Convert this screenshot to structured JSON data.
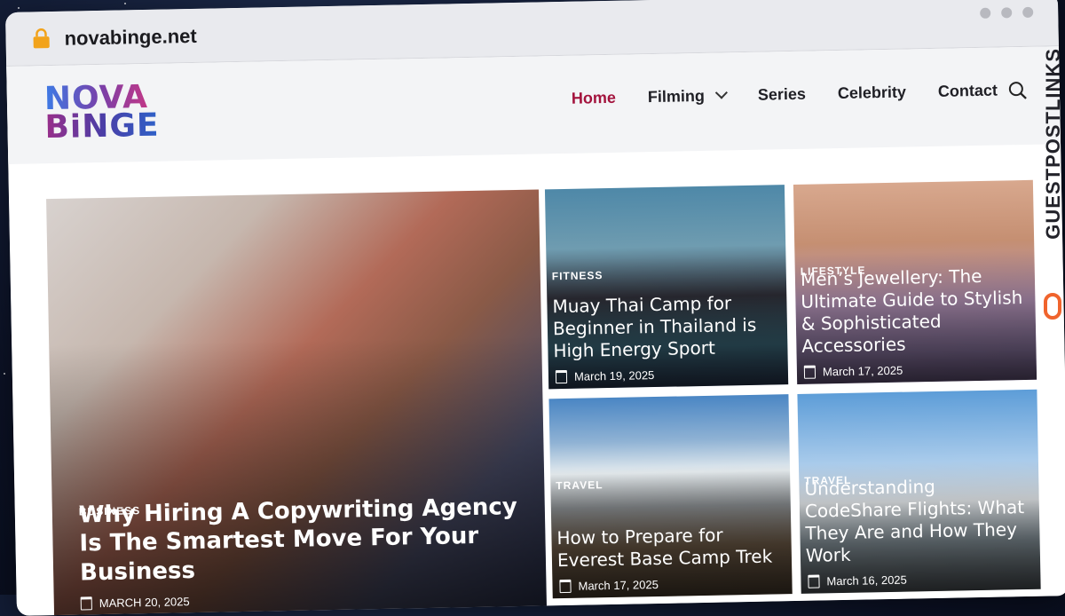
{
  "browser": {
    "url": "novabinge.net"
  },
  "logo": {
    "line1": "NOVA",
    "line2": "BiNGE"
  },
  "nav": {
    "items": [
      "Home",
      "Filming",
      "Series",
      "Celebrity",
      "Contact"
    ]
  },
  "cards": [
    {
      "category": "BUSINESS",
      "title": "Why Hiring A Copywriting Agency Is The Smartest Move For Your Business",
      "date": "MARCH 20, 2025"
    },
    {
      "category": "FITNESS",
      "title": "Muay Thai Camp for Beginner in Thailand is High Energy Sport",
      "date": "March 19, 2025"
    },
    {
      "category": "LIFESTYLE",
      "title": "Men’s Jewellery: The Ultimate Guide to Stylish & Sophisticated Accessories",
      "date": "March 17, 2025"
    },
    {
      "category": "TRAVEL",
      "title": "How to Prepare for Everest Base Camp Trek",
      "date": "March 17, 2025"
    },
    {
      "category": "TRAVEL",
      "title": "Understanding CodeShare Flights: What They Are and How They Work",
      "date": "March 16, 2025"
    }
  ],
  "side_tag": {
    "text": "GUESTPOSTLINKS"
  },
  "colors": {
    "accent": "#a3133d",
    "tag_orange": "#f0642d"
  }
}
